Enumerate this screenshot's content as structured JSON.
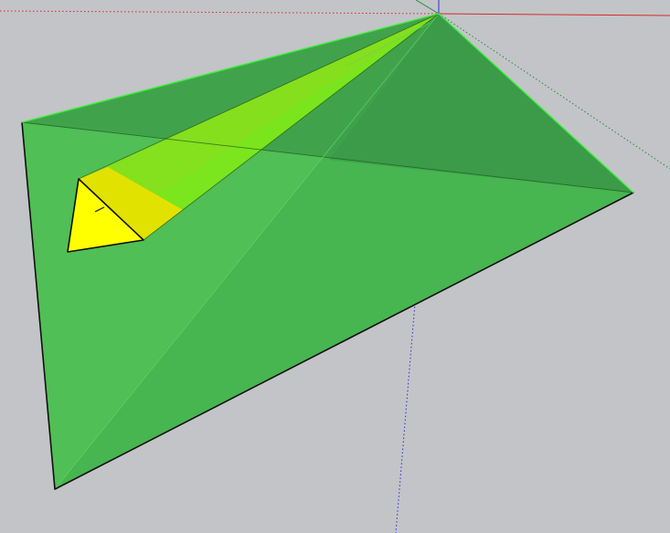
{
  "scene": {
    "colors": {
      "background": "#c3c4c7",
      "red_axis": "#d42a2a",
      "green_axis": "#1f8f3a",
      "blue_axis": "#2b2bd6",
      "pyramid_face_light": "#4cbf52",
      "pyramid_face_dark": "#3a9a48",
      "selected_edge": "#3bf03b",
      "edge": "#101010",
      "highlight_yellow": "#ffff00",
      "highlight_yellow_green": "#7de81a"
    }
  }
}
